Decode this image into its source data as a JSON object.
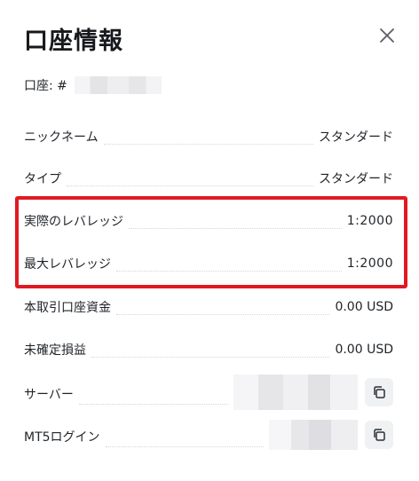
{
  "header": {
    "title": "口座情報",
    "close_icon": "close-icon"
  },
  "account": {
    "label": "口座: #"
  },
  "rows": [
    {
      "label": "ニックネーム",
      "value": "スタンダード"
    },
    {
      "label": "タイプ",
      "value": "スタンダード"
    },
    {
      "label": "実際のレバレッジ",
      "value": "1:2000"
    },
    {
      "label": "最大レバレッジ",
      "value": "1:2000"
    },
    {
      "label": "本取引口座資金",
      "value": "0.00 USD"
    },
    {
      "label": "未確定損益",
      "value": "0.00 USD"
    },
    {
      "label": "サーバー"
    },
    {
      "label": "MT5ログイン"
    }
  ],
  "colors": {
    "highlight_border": "#e01a22",
    "copy_button_bg": "#f0f1f3"
  },
  "icons": {
    "copy": "copy-icon"
  }
}
